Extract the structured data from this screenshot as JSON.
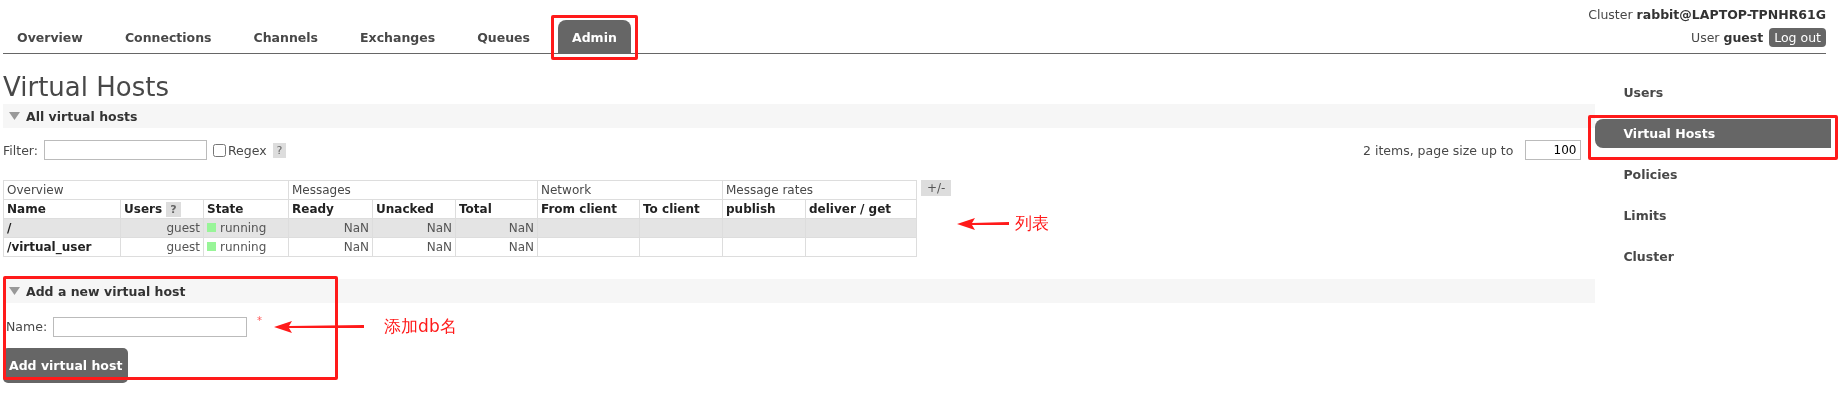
{
  "header": {
    "cluster_label": "Cluster",
    "cluster_name": "rabbit@LAPTOP-TPNHR61G",
    "user_label": "User",
    "user_name": "guest",
    "logout": "Log out"
  },
  "tabs": [
    {
      "label": "Overview",
      "selected": false,
      "annotated": false
    },
    {
      "label": "Connections",
      "selected": false,
      "annotated": false
    },
    {
      "label": "Channels",
      "selected": false,
      "annotated": false
    },
    {
      "label": "Exchanges",
      "selected": false,
      "annotated": false
    },
    {
      "label": "Queues",
      "selected": false,
      "annotated": false
    },
    {
      "label": "Admin",
      "selected": true,
      "annotated": true
    }
  ],
  "title": "Virtual Hosts",
  "all_section": {
    "title": "All virtual hosts",
    "expanded": true,
    "filter_label": "Filter:",
    "regex_label": "Regex",
    "regex_checked": false,
    "help": "?",
    "page_info": "2 items, page size up to",
    "page_size": "100"
  },
  "table": {
    "groups": [
      {
        "label": "Overview"
      },
      {
        "label": "Messages"
      },
      {
        "label": "Network"
      },
      {
        "label": "Message rates"
      }
    ],
    "columns": [
      {
        "label": "Name"
      },
      {
        "label": "Users",
        "help": "?"
      },
      {
        "label": "State"
      },
      {
        "label": "Ready"
      },
      {
        "label": "Unacked"
      },
      {
        "label": "Total"
      },
      {
        "label": "From client"
      },
      {
        "label": "To client"
      },
      {
        "label": "publish"
      },
      {
        "label": "deliver / get"
      }
    ],
    "toggle": "+/-",
    "rows": [
      {
        "name": "/",
        "users": "guest",
        "state": "running",
        "ready": "NaN",
        "unacked": "NaN",
        "total": "NaN",
        "highlighted": true
      },
      {
        "name": "/virtual_user",
        "users": "guest",
        "state": "running",
        "ready": "NaN",
        "unacked": "NaN",
        "total": "NaN",
        "highlighted": false
      }
    ]
  },
  "add_section": {
    "title": "Add a new virtual host",
    "expanded": true,
    "annotated": true,
    "name_label": "Name:",
    "required_mark": "*",
    "button": "Add virtual host"
  },
  "sidebar": {
    "items": [
      {
        "label": "Users",
        "selected": false,
        "annotated": false
      },
      {
        "label": "Virtual Hosts",
        "selected": true,
        "annotated": true
      },
      {
        "label": "Policies",
        "selected": false,
        "annotated": false
      },
      {
        "label": "Limits",
        "selected": false,
        "annotated": false
      },
      {
        "label": "Cluster",
        "selected": false,
        "annotated": false
      }
    ]
  },
  "annotations": [
    {
      "label": "列表"
    },
    {
      "label": "添加db名"
    }
  ]
}
